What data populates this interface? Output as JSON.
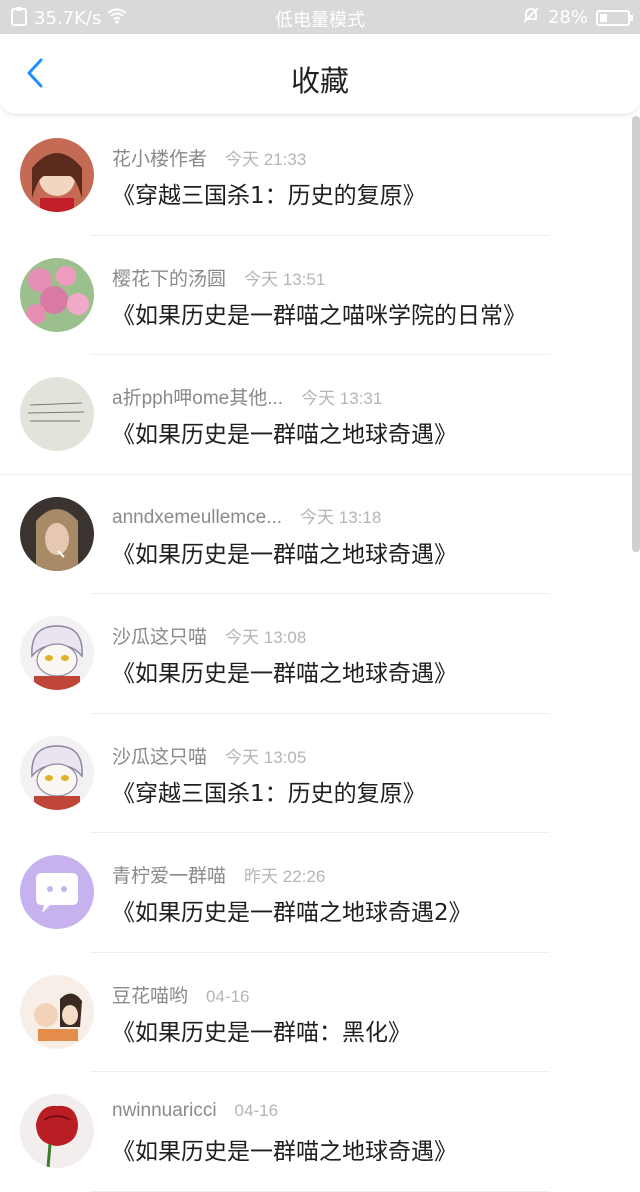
{
  "statusbar": {
    "speed": "35.7K/s",
    "mode": "低电量模式",
    "battery": "28%",
    "battery_level": 0.28
  },
  "header": {
    "title": "收藏"
  },
  "items": [
    {
      "name": "花小楼作者",
      "time": "今天 21:33",
      "title": "《穿越三国杀1：历史的复原》",
      "avatar_color": "#b75b4b"
    },
    {
      "name": "樱花下的汤圆",
      "time": "今天 13:51",
      "title": "《如果历史是一群喵之喵咪学院的日常》",
      "avatar_color": "#d98fb1"
    },
    {
      "name": "a折pph呷ome其他...",
      "time": "今天 13:31",
      "title": "《如果历史是一群喵之地球奇遇》",
      "avatar_color": "#dcdcd6"
    },
    {
      "name": "anndxemeullemce...",
      "time": "今天 13:18",
      "title": "《如果历史是一群喵之地球奇遇》",
      "avatar_color": "#7a6a5a"
    },
    {
      "name": "沙瓜这只喵",
      "time": "今天 13:08",
      "title": "《如果历史是一群喵之地球奇遇》",
      "avatar_color": "#efe9ef"
    },
    {
      "name": "沙瓜这只喵",
      "time": "今天 13:05",
      "title": "《穿越三国杀1：历史的复原》",
      "avatar_color": "#efe9ef"
    },
    {
      "name": "青柠爱一群喵",
      "time": "昨天 22:26",
      "title": "《如果历史是一群喵之地球奇遇2》",
      "avatar_color": "#c9b4ee"
    },
    {
      "name": "豆花喵哟",
      "time": "04-16",
      "title": "《如果历史是一群喵：黑化》",
      "avatar_color": "#f3e7df"
    },
    {
      "name": "nwinnuaricci",
      "time": "04-16",
      "title": "《如果历史是一群喵之地球奇遇》",
      "avatar_color": "#c12a2a"
    }
  ]
}
